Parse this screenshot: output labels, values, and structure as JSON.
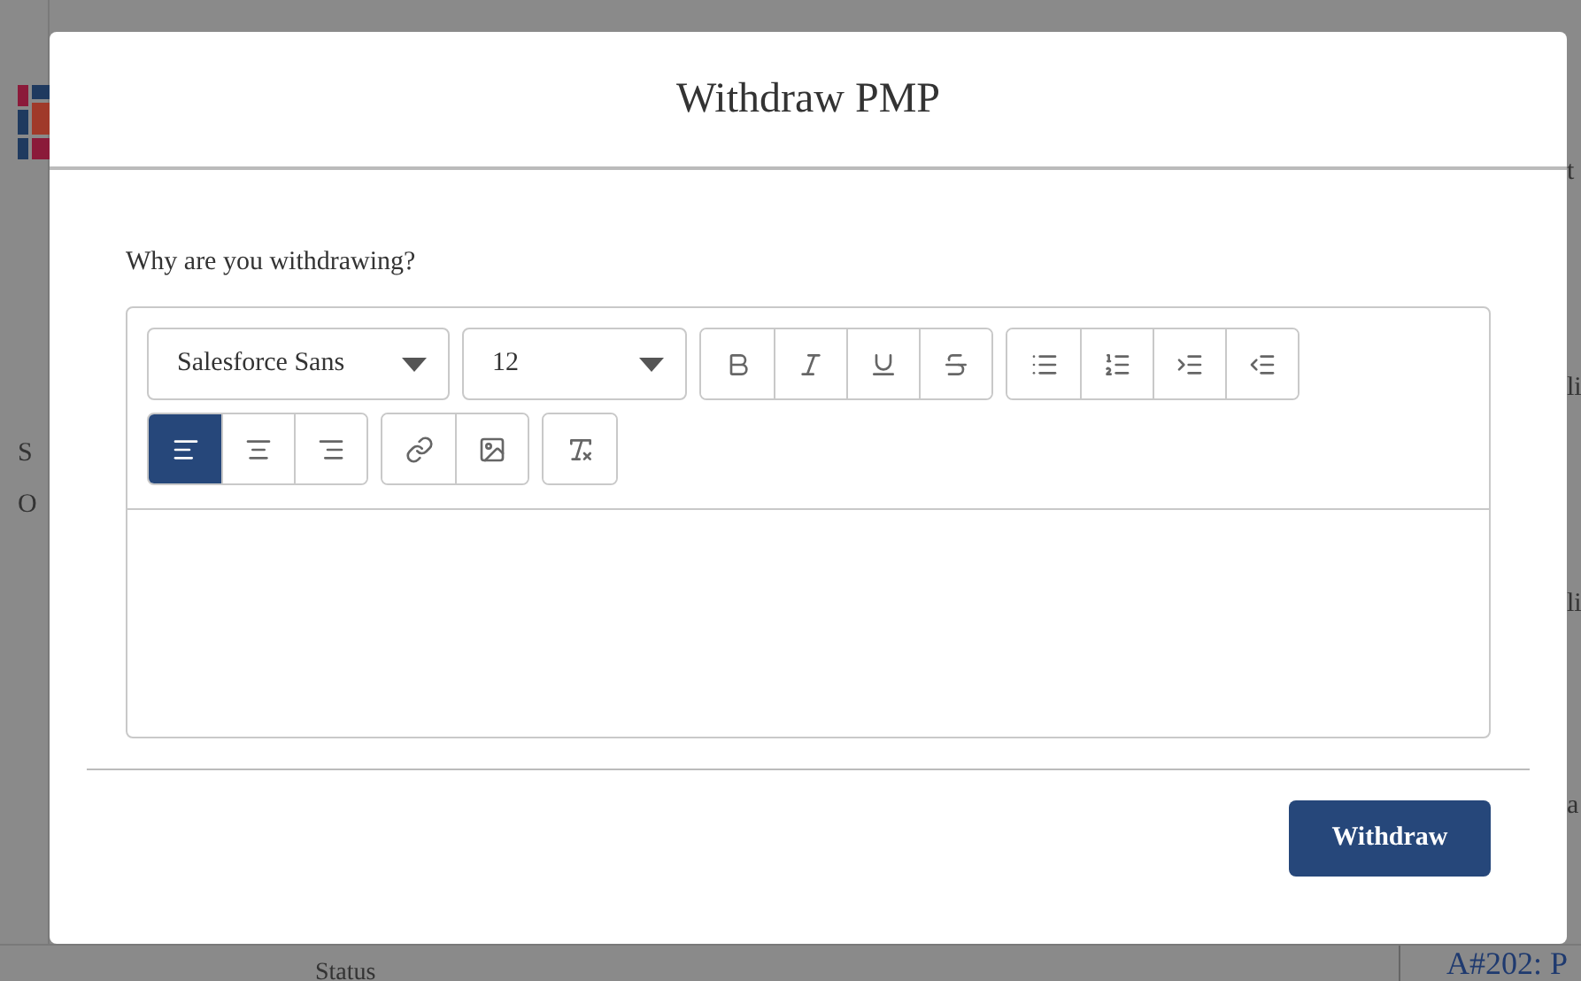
{
  "background": {
    "left_fragments": [
      "S",
      "O"
    ],
    "right_fragments": [
      "t",
      "li",
      "li",
      "a"
    ],
    "bottom_left": "Status",
    "bottom_right": "A#202: P"
  },
  "modal": {
    "title": "Withdraw PMP",
    "label": "Why are you withdrawing?",
    "editor": {
      "font_select": "Salesforce Sans",
      "size_select": "12",
      "groups": [
        [
          {
            "kind": "bold"
          },
          {
            "kind": "italic"
          },
          {
            "kind": "underline"
          },
          {
            "kind": "strike"
          }
        ],
        [
          {
            "kind": "bullets"
          },
          {
            "kind": "numbers"
          },
          {
            "kind": "indent"
          },
          {
            "kind": "outdent"
          }
        ],
        [
          {
            "kind": "align-left",
            "selected": true
          },
          {
            "kind": "align-center",
            "selected": false
          },
          {
            "kind": "align-right",
            "selected": false
          }
        ],
        [
          {
            "kind": "link"
          },
          {
            "kind": "image"
          }
        ],
        [
          {
            "kind": "clear-format"
          }
        ]
      ]
    },
    "button": "Withdraw"
  }
}
